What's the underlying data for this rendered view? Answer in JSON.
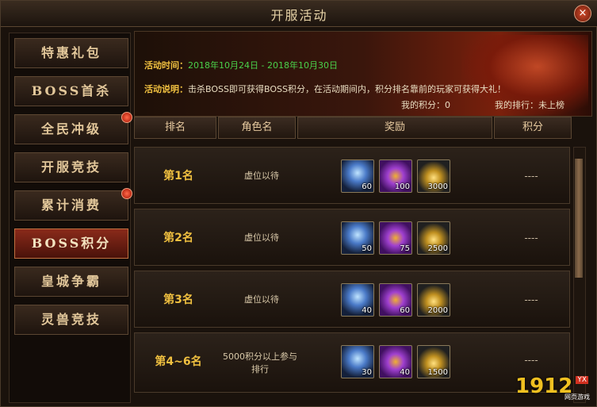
{
  "window": {
    "title": "开服活动",
    "close": "×"
  },
  "sidebar": {
    "items": [
      {
        "label": "特惠礼包",
        "active": false,
        "dot": false
      },
      {
        "label": "BOSS首杀",
        "active": false,
        "dot": false
      },
      {
        "label": "全民冲级",
        "active": false,
        "dot": true
      },
      {
        "label": "开服竞技",
        "active": false,
        "dot": false
      },
      {
        "label": "累计消费",
        "active": false,
        "dot": true
      },
      {
        "label": "BOSS积分",
        "active": true,
        "dot": false
      },
      {
        "label": "皇城争霸",
        "active": false,
        "dot": false
      },
      {
        "label": "灵兽竞技",
        "active": false,
        "dot": false
      }
    ]
  },
  "banner": {
    "time_label": "活动时间：",
    "time_value": "2018年10月24日 - 2018年10月30日",
    "desc_label": "活动说明：",
    "desc_value": "击杀BOSS即可获得BOSS积分，在活动期间内，积分排名靠前的玩家可获得大礼！",
    "my_score": "我的积分：0",
    "my_rank": "我的排行：未上榜"
  },
  "table": {
    "headers": [
      "排名",
      "角色名",
      "奖励",
      "积分"
    ],
    "rows": [
      {
        "rank": "第1名",
        "role": "虚位以待",
        "score": "----",
        "rewards": [
          "60",
          "100",
          "3000"
        ]
      },
      {
        "rank": "第2名",
        "role": "虚位以待",
        "score": "----",
        "rewards": [
          "50",
          "75",
          "2500"
        ]
      },
      {
        "rank": "第3名",
        "role": "虚位以待",
        "score": "----",
        "rewards": [
          "40",
          "60",
          "2000"
        ]
      },
      {
        "rank": "第4~6名",
        "role": "5000积分以上参与排行",
        "score": "----",
        "rewards": [
          "30",
          "40",
          "1500"
        ]
      }
    ]
  },
  "logo": {
    "num": "1912",
    "tag": "YX",
    "sub": "网页游戏"
  }
}
